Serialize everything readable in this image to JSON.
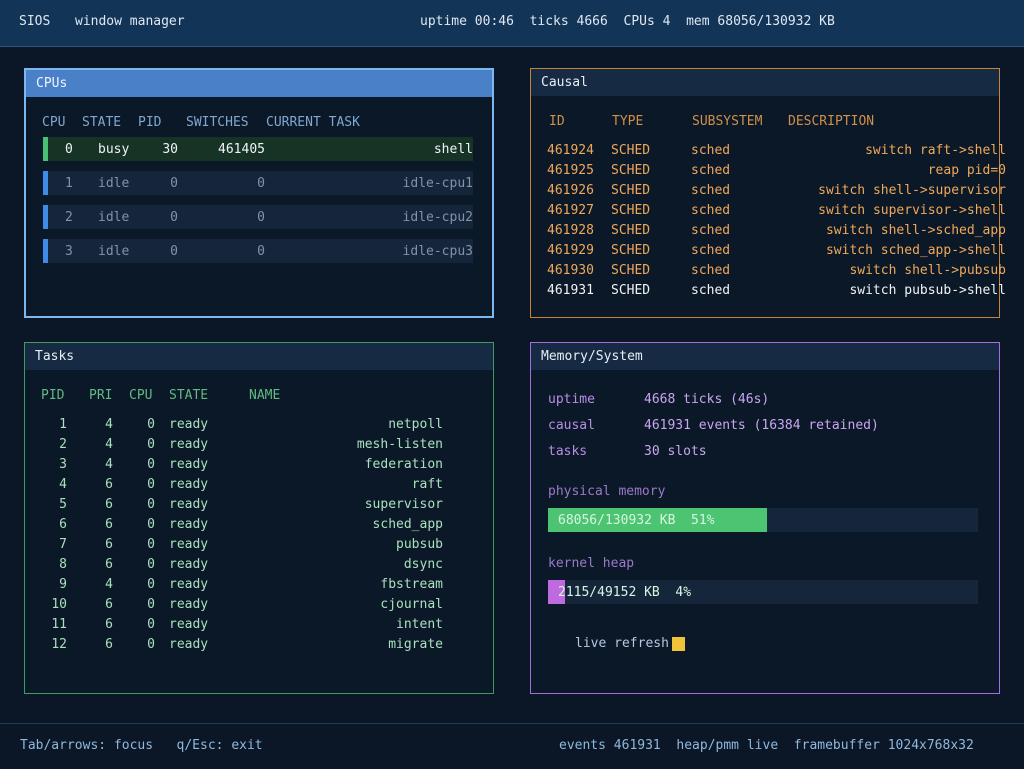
{
  "topbar": {
    "brand": "SIOS",
    "title": "window manager",
    "stats": "uptime 00:46  ticks 4666  CPUs 4  mem 68056/130932 KB"
  },
  "cpus": {
    "title": "CPUs",
    "headers": [
      "CPU",
      "STATE",
      "PID",
      "SWITCHES",
      "CURRENT TASK"
    ],
    "rows": [
      {
        "cpu": "0",
        "state": "busy",
        "pid": "30",
        "switches": "461405",
        "task": "shell"
      },
      {
        "cpu": "1",
        "state": "idle",
        "pid": "0",
        "switches": "0",
        "task": "idle-cpu1"
      },
      {
        "cpu": "2",
        "state": "idle",
        "pid": "0",
        "switches": "0",
        "task": "idle-cpu2"
      },
      {
        "cpu": "3",
        "state": "idle",
        "pid": "0",
        "switches": "0",
        "task": "idle-cpu3"
      }
    ]
  },
  "causal": {
    "title": "Causal",
    "headers": [
      "ID",
      "TYPE",
      "SUBSYSTEM",
      "DESCRIPTION"
    ],
    "rows": [
      {
        "id": "461924",
        "type": "SCHED",
        "subsystem": "sched",
        "desc": "switch raft->shell"
      },
      {
        "id": "461925",
        "type": "SCHED",
        "subsystem": "sched",
        "desc": "reap pid=0"
      },
      {
        "id": "461926",
        "type": "SCHED",
        "subsystem": "sched",
        "desc": "switch shell->supervisor"
      },
      {
        "id": "461927",
        "type": "SCHED",
        "subsystem": "sched",
        "desc": "switch supervisor->shell"
      },
      {
        "id": "461928",
        "type": "SCHED",
        "subsystem": "sched",
        "desc": "switch shell->sched_app"
      },
      {
        "id": "461929",
        "type": "SCHED",
        "subsystem": "sched",
        "desc": "switch sched_app->shell"
      },
      {
        "id": "461930",
        "type": "SCHED",
        "subsystem": "sched",
        "desc": "switch shell->pubsub"
      },
      {
        "id": "461931",
        "type": "SCHED",
        "subsystem": "sched",
        "desc": "switch pubsub->shell"
      }
    ]
  },
  "tasks": {
    "title": "Tasks",
    "headers": [
      "PID",
      "PRI",
      "CPU",
      "STATE",
      "NAME"
    ],
    "rows": [
      {
        "pid": "1",
        "pri": "4",
        "cpu": "0",
        "state": "ready",
        "name": "netpoll"
      },
      {
        "pid": "2",
        "pri": "4",
        "cpu": "0",
        "state": "ready",
        "name": "mesh-listen"
      },
      {
        "pid": "3",
        "pri": "4",
        "cpu": "0",
        "state": "ready",
        "name": "federation"
      },
      {
        "pid": "4",
        "pri": "6",
        "cpu": "0",
        "state": "ready",
        "name": "raft"
      },
      {
        "pid": "5",
        "pri": "6",
        "cpu": "0",
        "state": "ready",
        "name": "supervisor"
      },
      {
        "pid": "6",
        "pri": "6",
        "cpu": "0",
        "state": "ready",
        "name": "sched_app"
      },
      {
        "pid": "7",
        "pri": "6",
        "cpu": "0",
        "state": "ready",
        "name": "pubsub"
      },
      {
        "pid": "8",
        "pri": "6",
        "cpu": "0",
        "state": "ready",
        "name": "dsync"
      },
      {
        "pid": "9",
        "pri": "4",
        "cpu": "0",
        "state": "ready",
        "name": "fbstream"
      },
      {
        "pid": "10",
        "pri": "6",
        "cpu": "0",
        "state": "ready",
        "name": "cjournal"
      },
      {
        "pid": "11",
        "pri": "6",
        "cpu": "0",
        "state": "ready",
        "name": "intent"
      },
      {
        "pid": "12",
        "pri": "6",
        "cpu": "0",
        "state": "ready",
        "name": "migrate"
      }
    ]
  },
  "memory": {
    "title": "Memory/System",
    "stats": [
      {
        "label": "uptime",
        "value": "4668 ticks (46s)"
      },
      {
        "label": "causal",
        "value": "461931 events (16384 retained)"
      },
      {
        "label": "tasks",
        "value": "30 slots"
      }
    ],
    "physical": {
      "label": "physical memory",
      "text": "68056/130932 KB  51%",
      "fraction": 0.51,
      "color": "#4cc472"
    },
    "heap": {
      "label": "kernel heap",
      "text": "2115/49152 KB  4%",
      "fraction": 0.04,
      "color": "#c06ae0"
    },
    "refresh_label": "live refresh"
  },
  "footer": {
    "left": "Tab/arrows: focus   q/Esc: exit",
    "right": "events 461931  heap/pmm live  framebuffer 1024x768x32"
  },
  "colors": {
    "cpu_border": "#7cb8f0",
    "causal_border": "#c5843a",
    "tasks_border": "#3e9b5e",
    "memory_border": "#a46ee0"
  }
}
